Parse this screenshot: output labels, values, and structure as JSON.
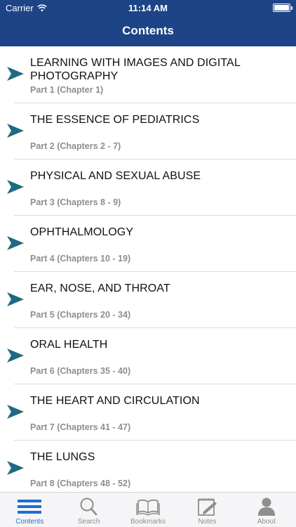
{
  "status_bar": {
    "carrier": "Carrier",
    "time": "11:14 AM"
  },
  "nav": {
    "title": "Contents"
  },
  "colors": {
    "header": "#1d4486",
    "arrow": "#1e6a80",
    "active_tab": "#1d6fcf"
  },
  "rows": [
    {
      "title": "LEARNING WITH IMAGES AND DIGITAL PHOTOGRAPHY",
      "subtitle": "Part 1 (Chapter 1)"
    },
    {
      "title": "THE ESSENCE OF PEDIATRICS",
      "subtitle": "Part 2 (Chapters 2 - 7)"
    },
    {
      "title": "PHYSICAL AND SEXUAL ABUSE",
      "subtitle": "Part 3 (Chapters 8 - 9)"
    },
    {
      "title": "OPHTHALMOLOGY",
      "subtitle": "Part 4 (Chapters 10 - 19)"
    },
    {
      "title": "EAR, NOSE, AND THROAT",
      "subtitle": "Part 5 (Chapters 20 - 34)"
    },
    {
      "title": "ORAL HEALTH",
      "subtitle": "Part 6 (Chapters 35 - 40)"
    },
    {
      "title": "THE HEART AND CIRCULATION",
      "subtitle": "Part 7 (Chapters 41 - 47)"
    },
    {
      "title": "THE LUNGS",
      "subtitle": "Part 8 (Chapters 48 - 52)"
    }
  ],
  "tabs": [
    {
      "label": "Contents",
      "icon": "list-icon"
    },
    {
      "label": "Search",
      "icon": "search-icon"
    },
    {
      "label": "Bookmarks",
      "icon": "book-icon"
    },
    {
      "label": "Notes",
      "icon": "notepad-icon"
    },
    {
      "label": "About",
      "icon": "person-icon"
    }
  ]
}
